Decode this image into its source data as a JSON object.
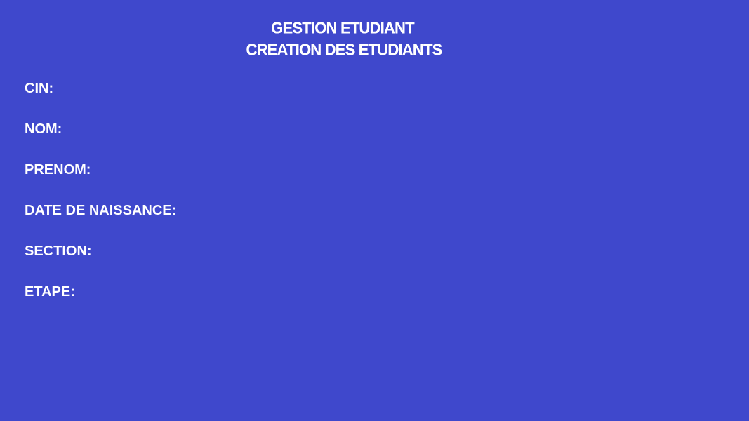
{
  "header": {
    "title": "GESTION ETUDIANT",
    "subtitle": "CREATION DES ETUDIANTS"
  },
  "form": {
    "fields": [
      {
        "label": "CIN:"
      },
      {
        "label": "NOM:"
      },
      {
        "label": "PRENOM:"
      },
      {
        "label": "DATE DE NAISSANCE:"
      },
      {
        "label": "SECTION:"
      },
      {
        "label": "ETAPE:"
      }
    ]
  },
  "colors": {
    "background": "#3F48CC",
    "text": "#FFFFFF"
  }
}
